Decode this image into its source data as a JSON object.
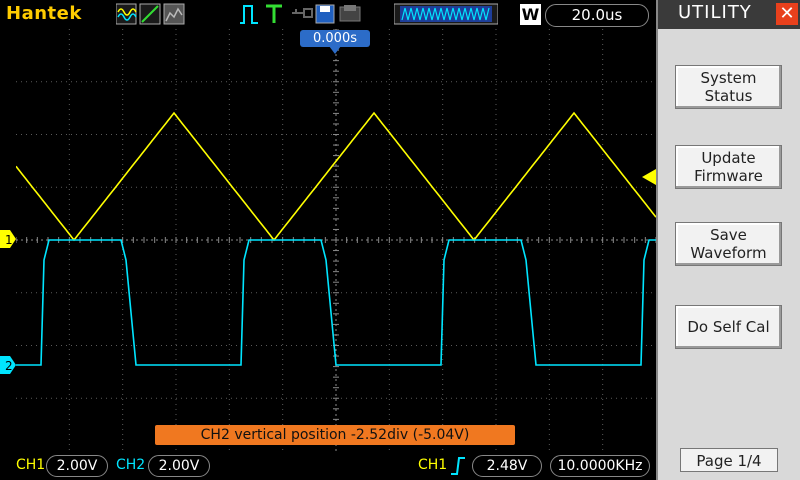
{
  "topbar": {
    "brand": "Hantek",
    "timebase": "20.0us",
    "mode_badge": "W"
  },
  "screen": {
    "trigger_time": "0.000s",
    "status_message": "CH2 vertical position -2.52div (-5.04V)",
    "ch1_marker": "1",
    "ch2_marker": "2"
  },
  "bottombar": {
    "ch1_label": "CH1",
    "ch1_volts": "2.00V",
    "ch2_label": "CH2",
    "ch2_volts": "2.00V",
    "trigger_source": "CH1",
    "trigger_level": "2.48V",
    "frequency": "10.0000KHz"
  },
  "panel": {
    "title": "UTILITY",
    "buttons": [
      {
        "line1": "System",
        "line2": "Status"
      },
      {
        "line1": "Update",
        "line2": "Firmware"
      },
      {
        "line1": "Save",
        "line2": "Waveform"
      },
      {
        "line1": "Do Self Cal",
        "line2": ""
      }
    ],
    "page": "Page 1/4"
  },
  "colors": {
    "ch1": "#ffff00",
    "ch2": "#00e5ff",
    "brand": "#ffcc00",
    "status_bg": "#f07820",
    "trigger_marker": "#2c6cc8"
  },
  "icons": {
    "waveform_mode": "waveform-icon",
    "trigger_type": "edge-trigger-icon",
    "save": "save-icon",
    "print": "print-icon",
    "usb": "usb-icon"
  }
}
